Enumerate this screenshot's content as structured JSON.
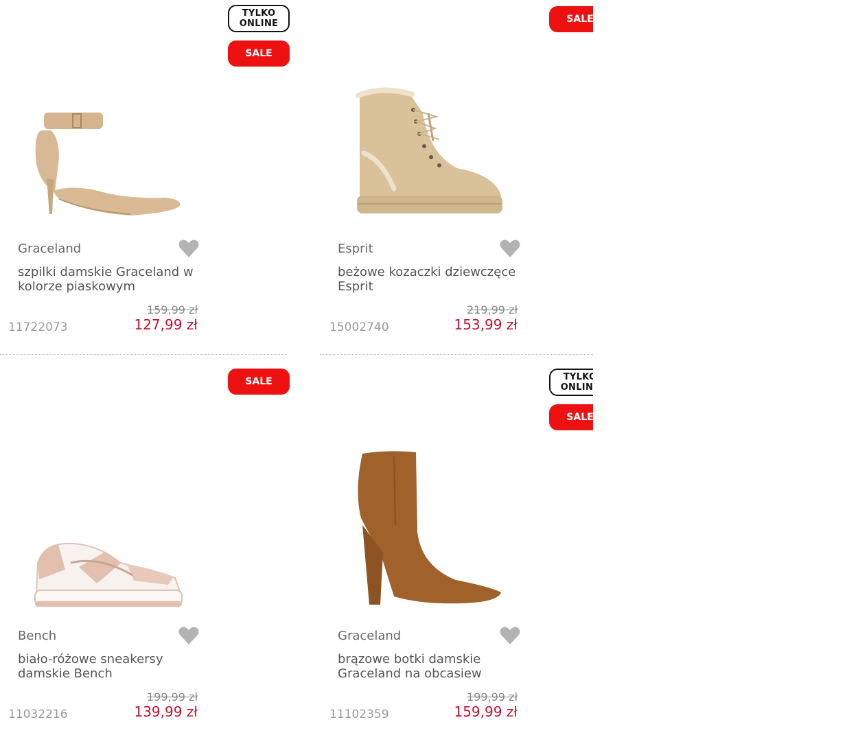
{
  "badges": {
    "online": "TYLKO ONLINE",
    "online_line1": "TYLKO",
    "online_line2": "ONLINE",
    "sale": "SALE"
  },
  "colors": {
    "sale": "#ee1111",
    "price": "#c8102e"
  },
  "products": [
    {
      "brand": "Graceland",
      "title": "szpilki damskie Graceland w kolorze piaskowym",
      "old_price": "159,99 zł",
      "price": "127,99 zł",
      "sku": "11722073",
      "online_only": true,
      "sale": true
    },
    {
      "brand": "Esprit",
      "title": "beżowe kozaczki dziewczęce Esprit",
      "old_price": "219,99 zł",
      "price": "153,99 zł",
      "sku": "15002740",
      "online_only": false,
      "sale": true
    },
    {
      "brand": "Bench",
      "title": "biało-różowe sneakersy damskie Bench",
      "old_price": "199,99 zł",
      "price": "139,99 zł",
      "sku": "11032216",
      "online_only": false,
      "sale": true
    },
    {
      "brand": "Graceland",
      "title": "brązowe botki damskie Graceland na obcasiew",
      "old_price": "199,99 zł",
      "price": "159,99 zł",
      "sku": "11102359",
      "online_only": true,
      "sale": true
    }
  ]
}
